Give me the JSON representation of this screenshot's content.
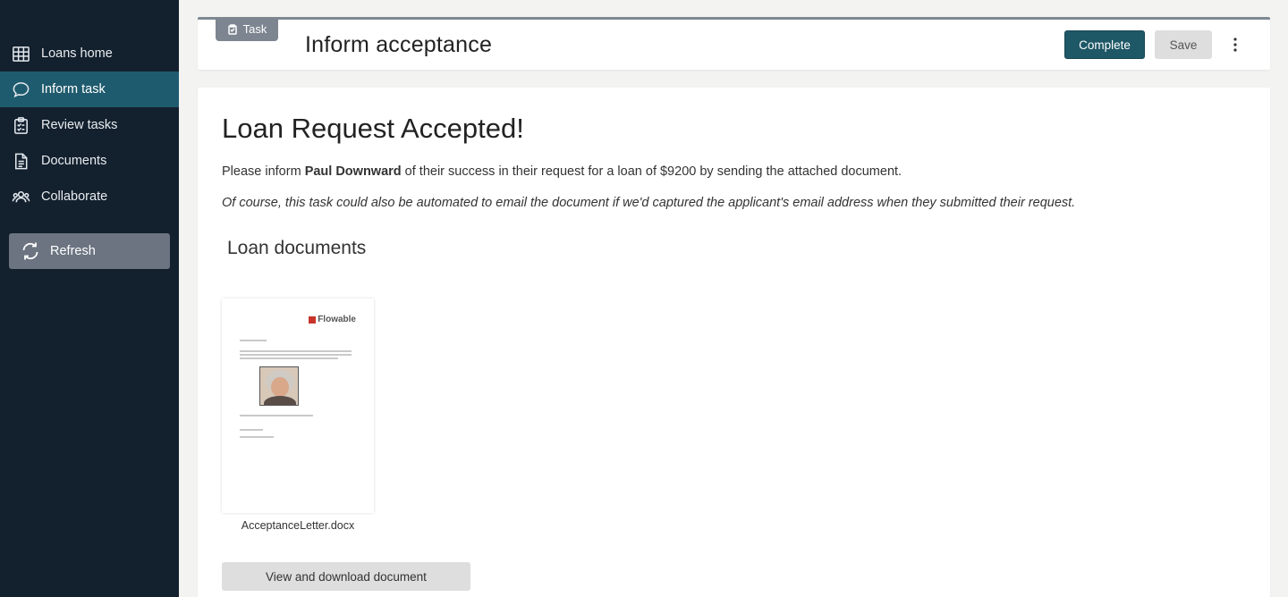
{
  "sidebar": {
    "items": [
      {
        "label": "Loans home",
        "icon": "table-grid-icon",
        "active": false
      },
      {
        "label": "Inform task",
        "icon": "chat-bubble-icon",
        "active": true
      },
      {
        "label": "Review tasks",
        "icon": "clipboard-icon",
        "active": false
      },
      {
        "label": "Documents",
        "icon": "document-icon",
        "active": false
      },
      {
        "label": "Collaborate",
        "icon": "people-icon",
        "active": false
      }
    ],
    "refresh_label": "Refresh"
  },
  "header": {
    "tab_label": "Task",
    "title": "Inform acceptance",
    "complete_label": "Complete",
    "save_label": "Save"
  },
  "main": {
    "heading": "Loan Request Accepted!",
    "intro_prefix": "Please inform ",
    "applicant_name": "Paul Downward",
    "intro_suffix": " of their success in their request for a loan of $9200 by sending the attached document.",
    "note": "Of course, this task could also be automated to email the document if we'd captured the applicant's email address when they submitted their request.",
    "documents_title": "Loan documents",
    "document": {
      "logo_text": "Flowable",
      "filename": "AcceptanceLetter.docx"
    },
    "view_button_label": "View and download document"
  },
  "colors": {
    "sidebar_bg": "#13202e",
    "sidebar_active": "#1f5b6e",
    "primary_button": "#1e5766",
    "page_bg": "#f3f3f1"
  }
}
